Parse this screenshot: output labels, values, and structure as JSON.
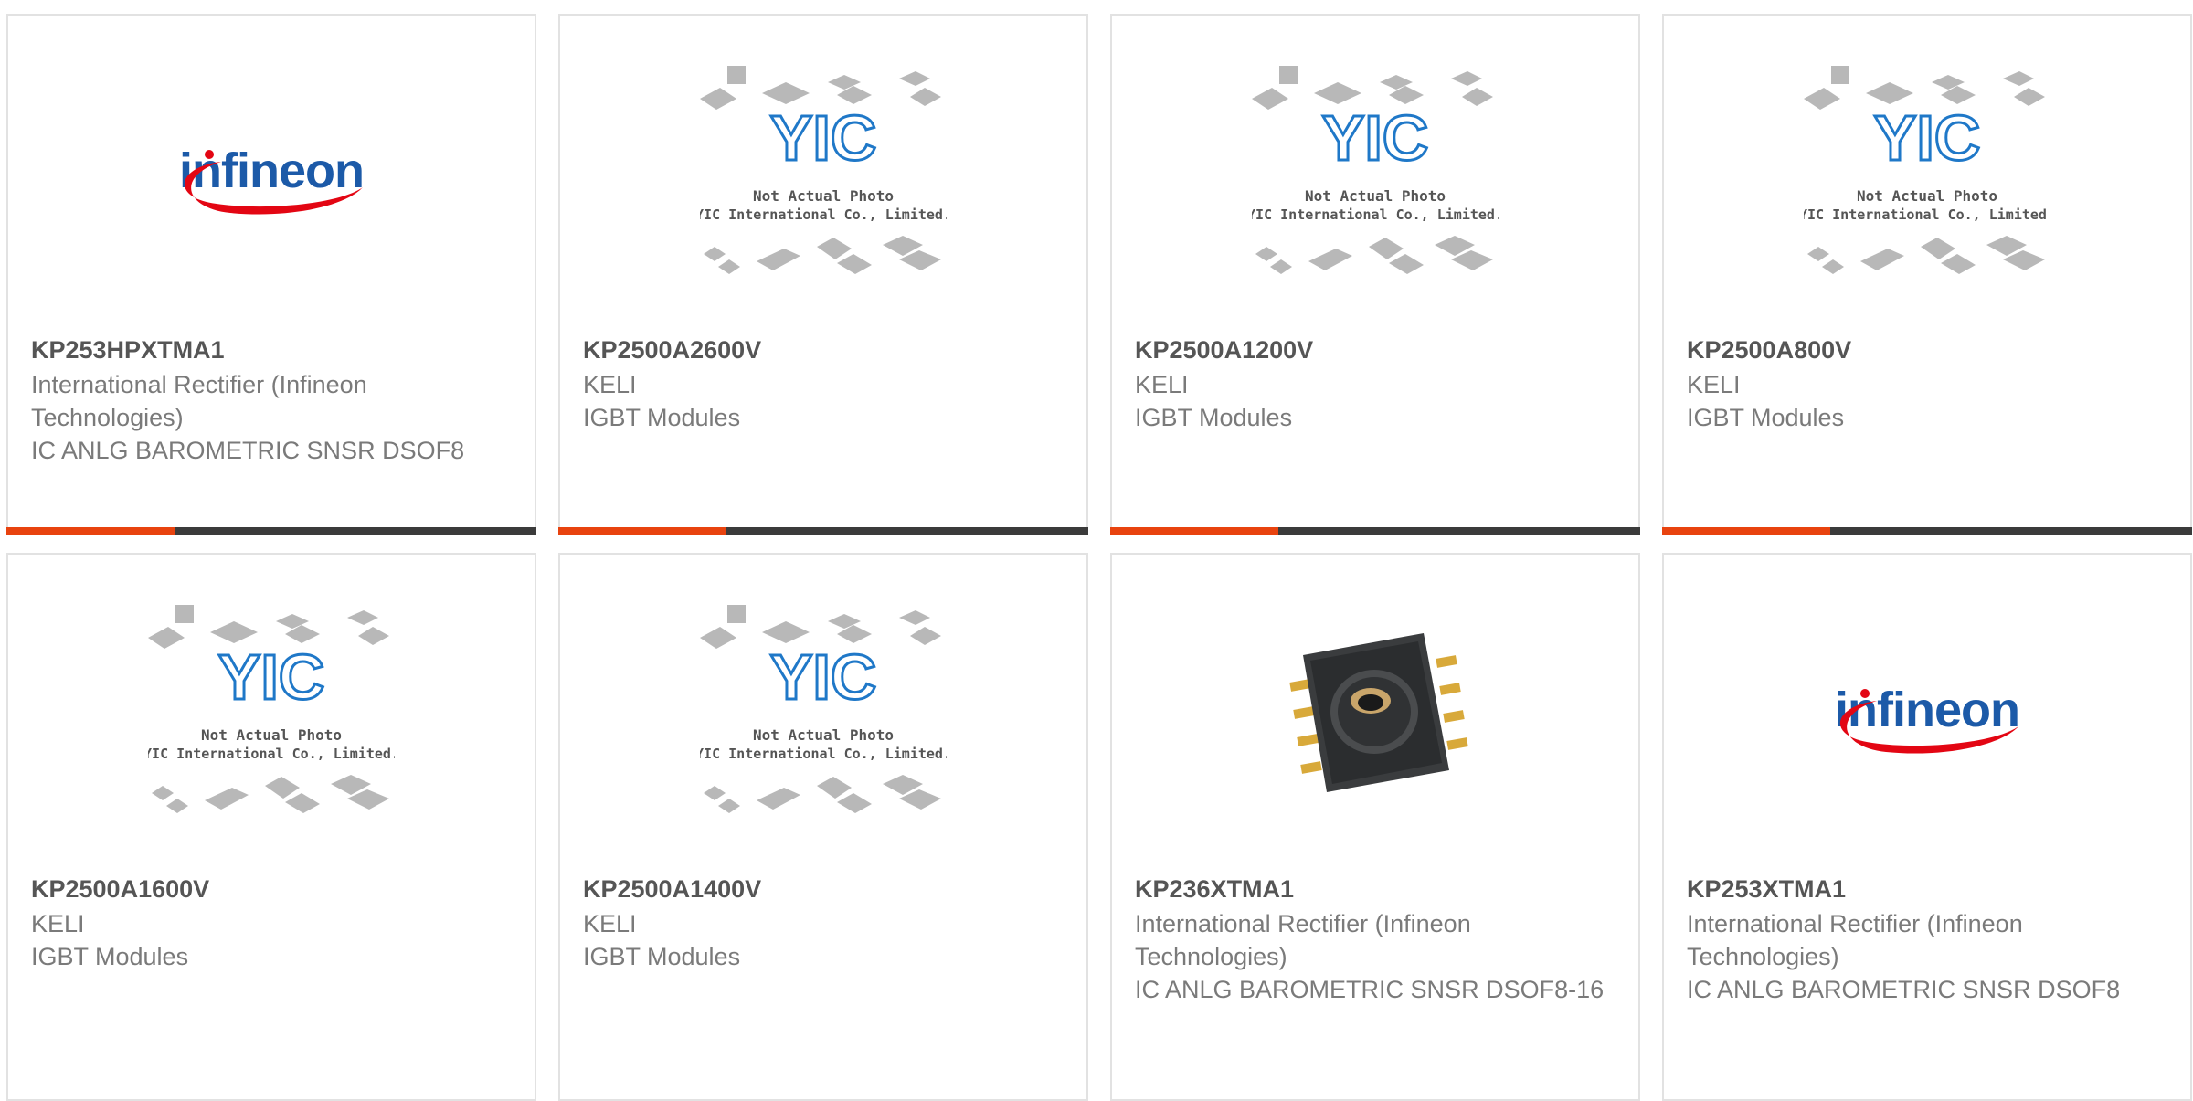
{
  "accent_color": "#e8430f",
  "bar_color": "#3b3b3b",
  "placeholder": {
    "line1": "Not Actual Photo",
    "line2": "YIC International Co., Limited.",
    "logo_text": "YIC"
  },
  "products": [
    {
      "part_number": "KP253HPXTMA1",
      "manufacturer": "International Rectifier (Infineon Technologies)",
      "description": "IC ANLG BAROMETRIC SNSR DSOF8",
      "image": "infineon-logo"
    },
    {
      "part_number": "KP2500A2600V",
      "manufacturer": "KELI",
      "description": "IGBT Modules",
      "image": "yic-placeholder"
    },
    {
      "part_number": "KP2500A1200V",
      "manufacturer": "KELI",
      "description": "IGBT Modules",
      "image": "yic-placeholder"
    },
    {
      "part_number": "KP2500A800V",
      "manufacturer": "KELI",
      "description": "IGBT Modules",
      "image": "yic-placeholder"
    },
    {
      "part_number": "KP2500A1600V",
      "manufacturer": "KELI",
      "description": "IGBT Modules",
      "image": "yic-placeholder"
    },
    {
      "part_number": "KP2500A1400V",
      "manufacturer": "KELI",
      "description": "IGBT Modules",
      "image": "yic-placeholder"
    },
    {
      "part_number": "KP236XTMA1",
      "manufacturer": "International Rectifier (Infineon Technologies)",
      "description": "IC ANLG BAROMETRIC SNSR DSOF8-16",
      "image": "sensor-chip"
    },
    {
      "part_number": "KP253XTMA1",
      "manufacturer": "International Rectifier (Infineon Technologies)",
      "description": "IC ANLG BAROMETRIC SNSR DSOF8",
      "image": "infineon-logo"
    }
  ]
}
